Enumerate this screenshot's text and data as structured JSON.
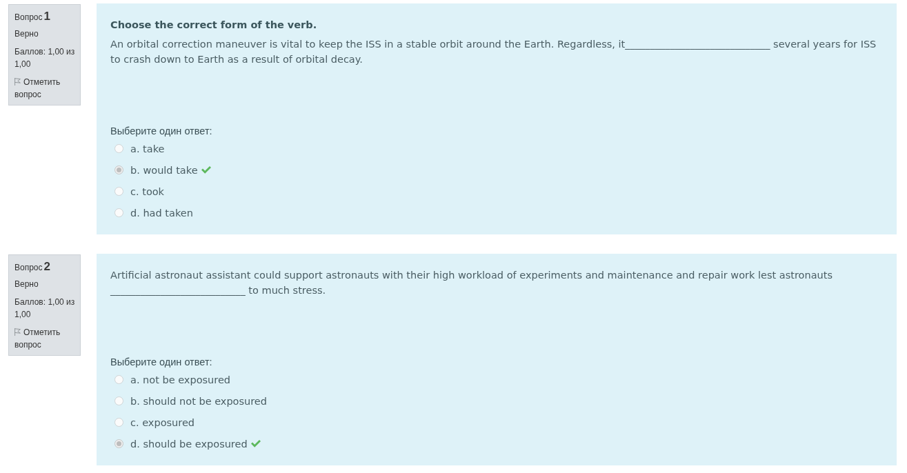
{
  "questions": [
    {
      "label": "Вопрос",
      "number": "1",
      "state": "Верно",
      "grade": "Баллов: 1,00 из 1,00",
      "flag_link": "Отметить вопрос",
      "instruction": "Choose the correct form of the verb.",
      "text": "An orbital correction maneuver is vital to keep the ISS in a stable orbit around the Earth. Regardless, it_____________________________ several years for ISS to crash down to Earth as a result of orbital decay.",
      "prompt": "Выберите один ответ:",
      "answers": [
        {
          "label": "a. take",
          "selected": false,
          "correct": false
        },
        {
          "label": "b. would take",
          "selected": true,
          "correct": true
        },
        {
          "label": "c. took",
          "selected": false,
          "correct": false
        },
        {
          "label": "d. had taken",
          "selected": false,
          "correct": false
        }
      ]
    },
    {
      "label": "Вопрос",
      "number": "2",
      "state": "Верно",
      "grade": "Баллов: 1,00 из 1,00",
      "flag_link": "Отметить вопрос",
      "text": "Artificial astronaut assistant could support astronauts with their high workload of experiments and maintenance and repair work lest astronauts ___________________________ to much stress.",
      "prompt": "Выберите один ответ:",
      "answers": [
        {
          "label": "a. not be exposured",
          "selected": false,
          "correct": false
        },
        {
          "label": "b. should not be exposured",
          "selected": false,
          "correct": false
        },
        {
          "label": "c. exposured",
          "selected": false,
          "correct": false
        },
        {
          "label": "d. should be exposured",
          "selected": true,
          "correct": true
        }
      ]
    }
  ]
}
